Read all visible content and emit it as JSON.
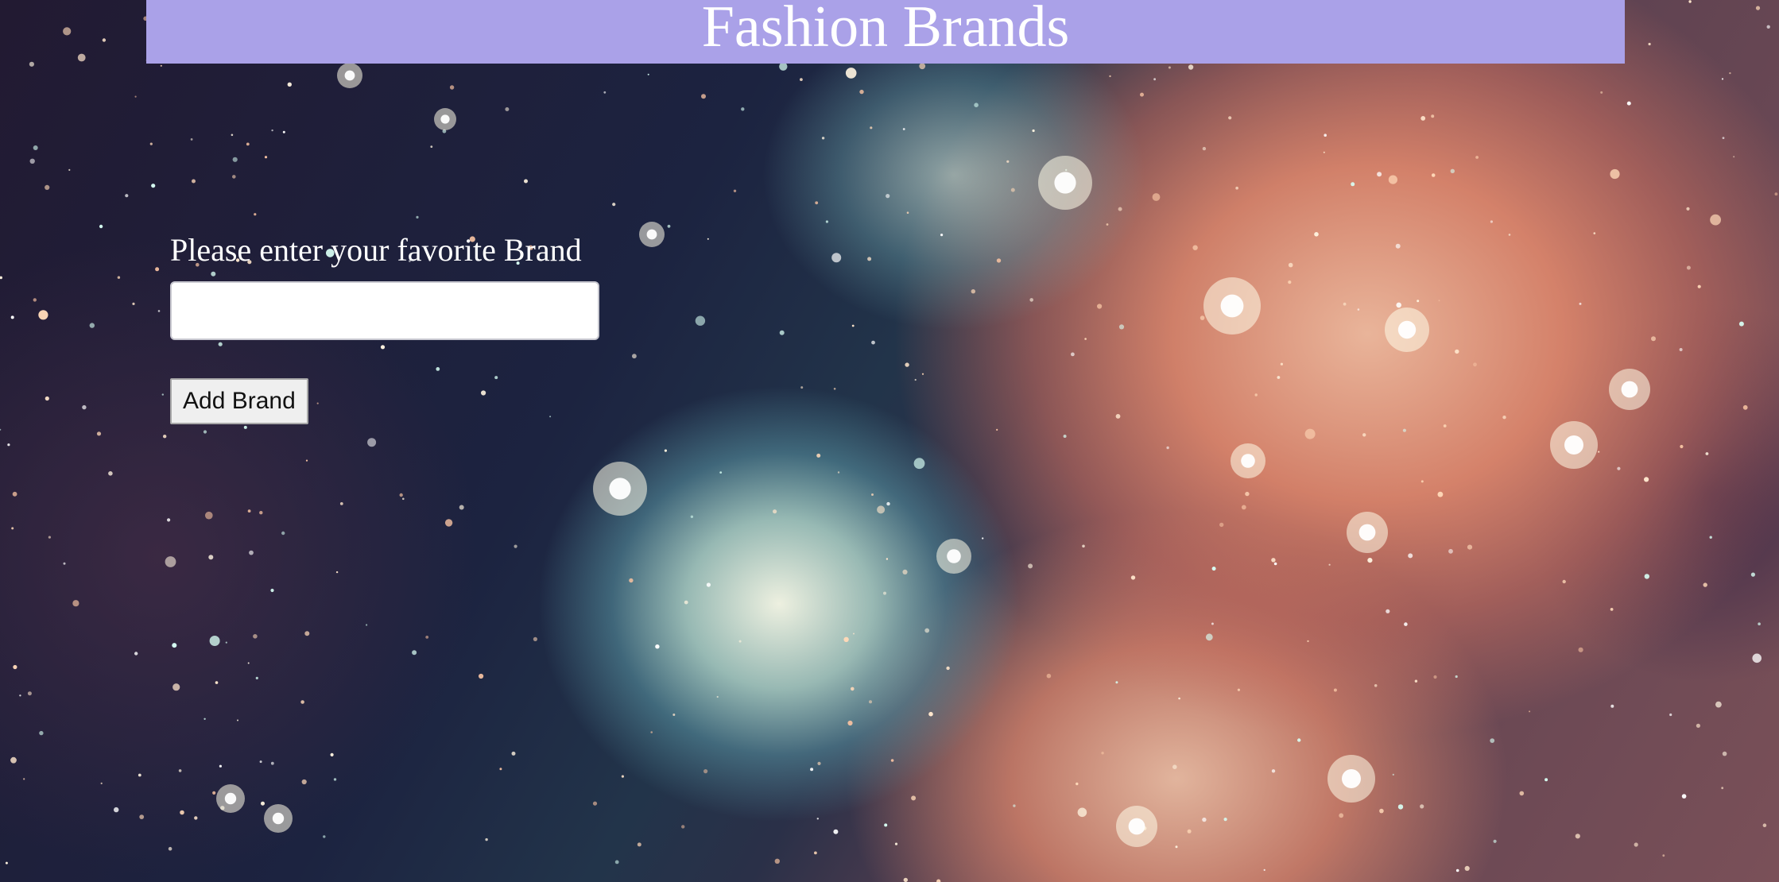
{
  "header": {
    "title": "Fashion Brands",
    "background_color": "#aaa1e8"
  },
  "form": {
    "label": "Please enter your favorite Brand",
    "input_value": "",
    "input_placeholder": "",
    "button_label": "Add Brand"
  },
  "background": {
    "description_icon": "nebula-starfield-image"
  }
}
